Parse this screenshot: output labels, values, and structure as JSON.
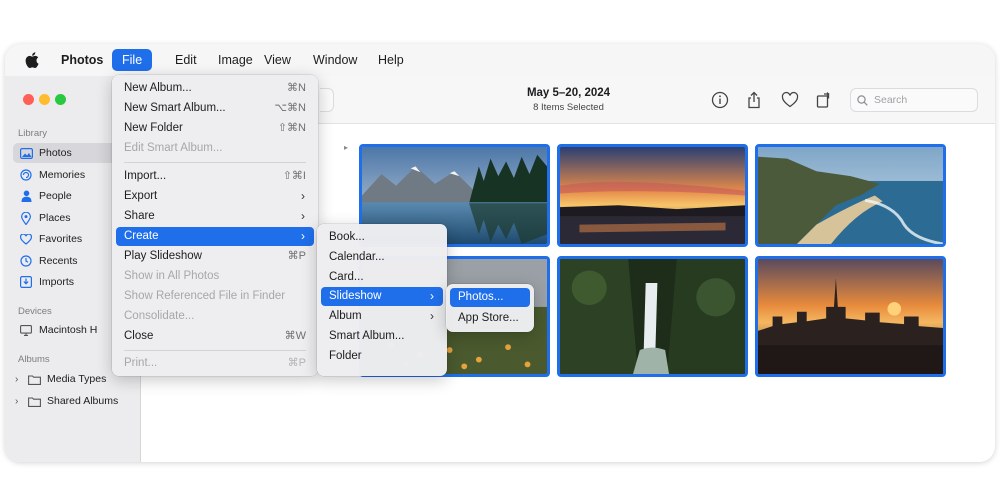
{
  "menubar": {
    "apple_icon": "apple-logo-icon",
    "items": [
      "Photos",
      "File",
      "Edit",
      "Image",
      "View",
      "Window",
      "Help"
    ],
    "active": "File"
  },
  "sidebar": {
    "library_label": "Library",
    "library_items": [
      {
        "label": "Photos",
        "icon": "photos-icon",
        "selected": true
      },
      {
        "label": "Memories",
        "icon": "memories-icon"
      },
      {
        "label": "People",
        "icon": "person-icon"
      },
      {
        "label": "Places",
        "icon": "pin-icon"
      },
      {
        "label": "Favorites",
        "icon": "heart-icon"
      },
      {
        "label": "Recents",
        "icon": "clock-icon"
      },
      {
        "label": "Imports",
        "icon": "imports-icon"
      }
    ],
    "devices_label": "Devices",
    "device_items": [
      {
        "label": "Macintosh H",
        "icon": "computer-icon"
      }
    ],
    "albums_label": "Albums",
    "album_items": [
      {
        "label": "Media Types",
        "icon": "folder-icon"
      },
      {
        "label": "Shared Albums",
        "icon": "folder-icon"
      }
    ]
  },
  "toolbar": {
    "date_range": "May 5–20, 2024",
    "selection": "8 Items Selected",
    "icons": [
      "info-icon",
      "share-icon",
      "heart-icon",
      "rotate-icon"
    ],
    "search_placeholder": "Search"
  },
  "file_menu": {
    "items": [
      {
        "label": "New Album...",
        "shortcut": "⌘N"
      },
      {
        "label": "New Smart Album...",
        "shortcut": "⌥⌘N"
      },
      {
        "label": "New Folder",
        "shortcut": "⇧⌘N"
      },
      {
        "label": "Edit Smart Album...",
        "disabled": true
      },
      {
        "label": "Import...",
        "shortcut": "⇧⌘I"
      },
      {
        "label": "Export",
        "submenu": true
      },
      {
        "label": "Share",
        "submenu": true
      },
      {
        "label": "Create",
        "submenu": true,
        "highlighted": true
      },
      {
        "label": "Play Slideshow",
        "shortcut": "⌘P"
      },
      {
        "label": "Show in All Photos",
        "disabled": true
      },
      {
        "label": "Show Referenced File in Finder",
        "disabled": true
      },
      {
        "label": "Consolidate...",
        "disabled": true
      },
      {
        "label": "Close",
        "shortcut": "⌘W"
      },
      {
        "label": "Print...",
        "shortcut": "⌘P",
        "disabled": true
      }
    ]
  },
  "create_menu": {
    "items": [
      {
        "label": "Book..."
      },
      {
        "label": "Calendar..."
      },
      {
        "label": "Card..."
      },
      {
        "label": "Slideshow",
        "submenu": true,
        "highlighted": true
      },
      {
        "label": "Album",
        "submenu": true
      },
      {
        "label": "Smart Album..."
      },
      {
        "label": "Folder"
      }
    ]
  },
  "slideshow_menu": {
    "items": [
      {
        "label": "Photos...",
        "highlighted": true
      },
      {
        "label": "App Store..."
      }
    ]
  },
  "colors": {
    "accent": "#1f6feb",
    "traffic_red": "#ff5f57",
    "traffic_yellow": "#febc2e",
    "traffic_green": "#28c840"
  }
}
